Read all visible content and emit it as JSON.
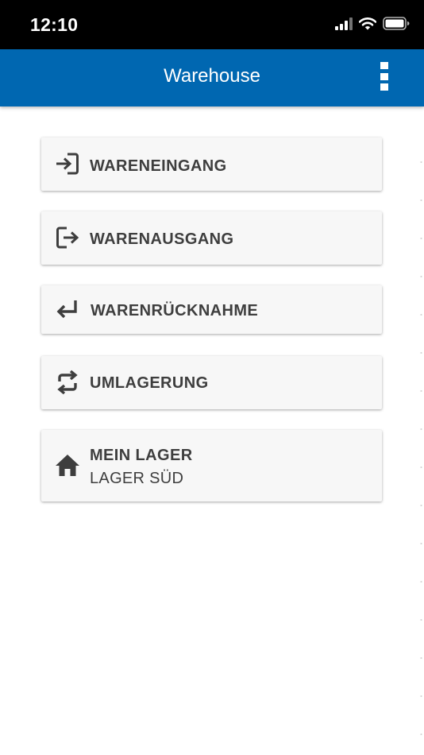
{
  "status_bar": {
    "time": "12:10",
    "icons": [
      "signal-icon",
      "wifi-icon",
      "battery-icon"
    ]
  },
  "app_bar": {
    "title": "Warehouse",
    "background": "#0067b1",
    "menu_icon": "more-vertical-icon"
  },
  "menu": {
    "items": [
      {
        "label": "WARENEINGANG",
        "icon": "login-icon"
      },
      {
        "label": "WARENAUSGANG",
        "icon": "logout-icon"
      },
      {
        "label": "WARENRÜCKNAHME",
        "icon": "return-arrow-icon"
      },
      {
        "label": "UMLAGERUNG",
        "icon": "swap-icon"
      },
      {
        "label": "MEIN LAGER",
        "sublabel": "LAGER SÜD",
        "icon": "home-icon"
      }
    ]
  }
}
